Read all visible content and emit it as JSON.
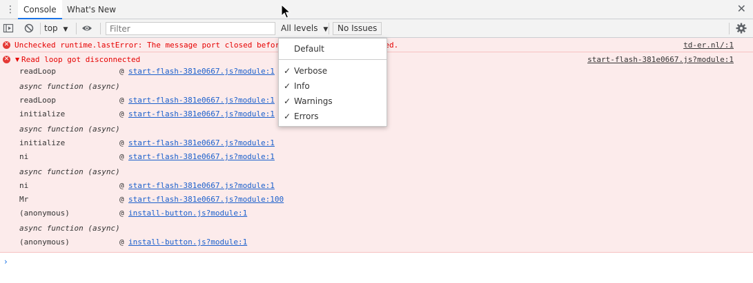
{
  "tabbar": {
    "tabs": [
      {
        "label": "Console",
        "active": true
      },
      {
        "label": "What's New",
        "active": false
      }
    ]
  },
  "toolbar": {
    "context": "top",
    "filter_placeholder": "Filter",
    "levels_label": "All levels",
    "issues_label": "No Issues"
  },
  "messages": {
    "first": {
      "text": "Unchecked runtime.lastError: The message port closed before a response was received.",
      "source": "td-er.nl/:1"
    },
    "second": {
      "text": "Read loop got disconnected",
      "source": "start-flash-381e0667.js?module:1"
    },
    "async_label": "async function (async)",
    "at_sign": "@",
    "frames": [
      {
        "fn": "readLoop",
        "loc": "start-flash-381e0667.js?module:1"
      },
      {
        "fn": "readLoop",
        "loc": "start-flash-381e0667.js?module:1"
      },
      {
        "fn": "initialize",
        "loc": "start-flash-381e0667.js?module:1"
      },
      {
        "fn": "initialize",
        "loc": "start-flash-381e0667.js?module:1"
      },
      {
        "fn": "ni",
        "loc": "start-flash-381e0667.js?module:1"
      },
      {
        "fn": "ni",
        "loc": "start-flash-381e0667.js?module:1"
      },
      {
        "fn": "Mr",
        "loc": "start-flash-381e0667.js?module:100"
      },
      {
        "fn": "(anonymous)",
        "loc": "install-button.js?module:1"
      },
      {
        "fn": "(anonymous)",
        "loc": "install-button.js?module:1"
      }
    ]
  },
  "dropdown": {
    "default_label": "Default",
    "items": [
      {
        "label": "Verbose",
        "checked": true
      },
      {
        "label": "Info",
        "checked": true
      },
      {
        "label": "Warnings",
        "checked": true
      },
      {
        "label": "Errors",
        "checked": true
      }
    ]
  },
  "colors": {
    "error_red": "#e60000",
    "error_bg": "#fcebeb",
    "link_blue": "#1a5fcc",
    "accent": "#1a73e8"
  }
}
